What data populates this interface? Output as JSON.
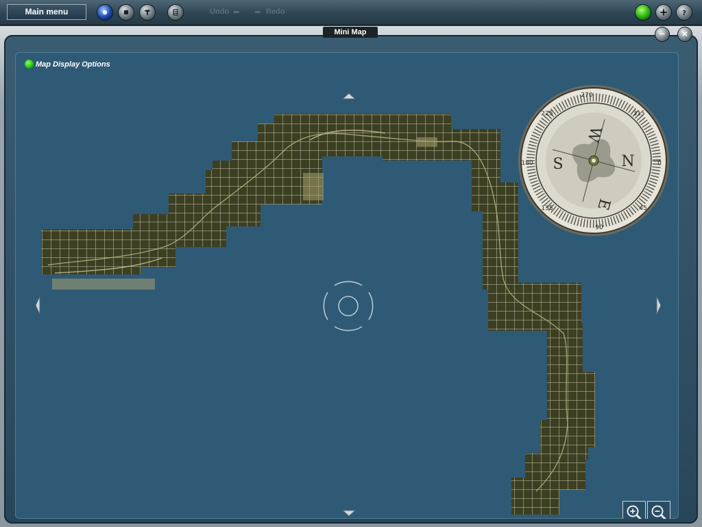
{
  "toolbar": {
    "main_menu_label": "Main menu",
    "undo_label": "Undo",
    "redo_label": "Redo"
  },
  "window": {
    "title": "Mini Map",
    "minimize_glyph": "−",
    "close_glyph": "×"
  },
  "map": {
    "display_options_label": "Map Display Options",
    "compass_labels": [
      "W",
      "N",
      "S",
      "E"
    ],
    "compass_degrees": [
      "270",
      "315",
      "0",
      "45",
      "90",
      "135",
      "180",
      "225"
    ]
  },
  "icons": [
    "globe-icon",
    "stop-icon",
    "tool-icon",
    "grid-icon",
    "undo-arrow-icon",
    "redo-arrow-icon",
    "status-led-icon",
    "add-icon",
    "help-icon",
    "zoom-in-icon",
    "zoom-out-icon",
    "compass-icon",
    "crosshair-icon"
  ],
  "colors": {
    "map_background": "#2e5a75",
    "terrain": "#3d3f22",
    "grid_line": "#c6ccb8",
    "led_green": "#2dd412"
  }
}
